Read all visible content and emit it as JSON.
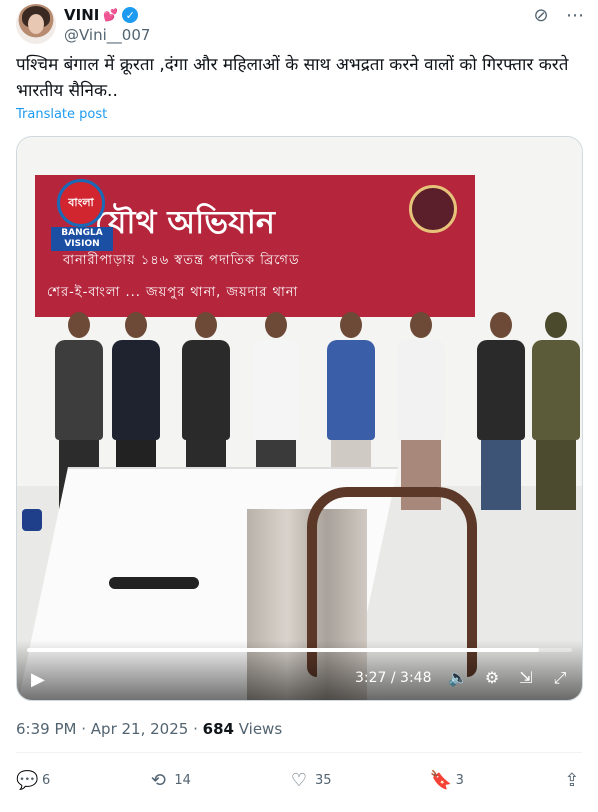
{
  "author": {
    "display_name": "VINI",
    "emoji": "💕",
    "handle": "@Vini__007"
  },
  "top_icons": [
    "grok-icon",
    "more-icon"
  ],
  "tweet": {
    "text": "पश्चिम बंगाल में क्रूरता ,दंगा और महिलाओं के साथ अभद्रता करने वालों को गिरफ्तार करते भारतीय सैनिक..",
    "translate_label": "Translate post"
  },
  "video": {
    "banner_title": "যৌথ অভিযান",
    "banner_line1": "বানারীপাড়ায় ১৪৬ স্বতন্ত্র পদাতিক ব্রিগেড",
    "banner_line2": "শের-ই-বাংলা ... জয়পুর থানা, জয়দার থানা",
    "logo_line1": "BANGLA",
    "logo_line2": "VISION",
    "time_display": "3:27 / 3:48",
    "progress": 0.94
  },
  "meta": {
    "time": "6:39 PM",
    "date": "Apr 21, 2025",
    "separator": "·",
    "views_count": "684",
    "views_label": "Views"
  },
  "actions": {
    "replies": "6",
    "reposts": "14",
    "likes": "35",
    "bookmarks": "3"
  }
}
